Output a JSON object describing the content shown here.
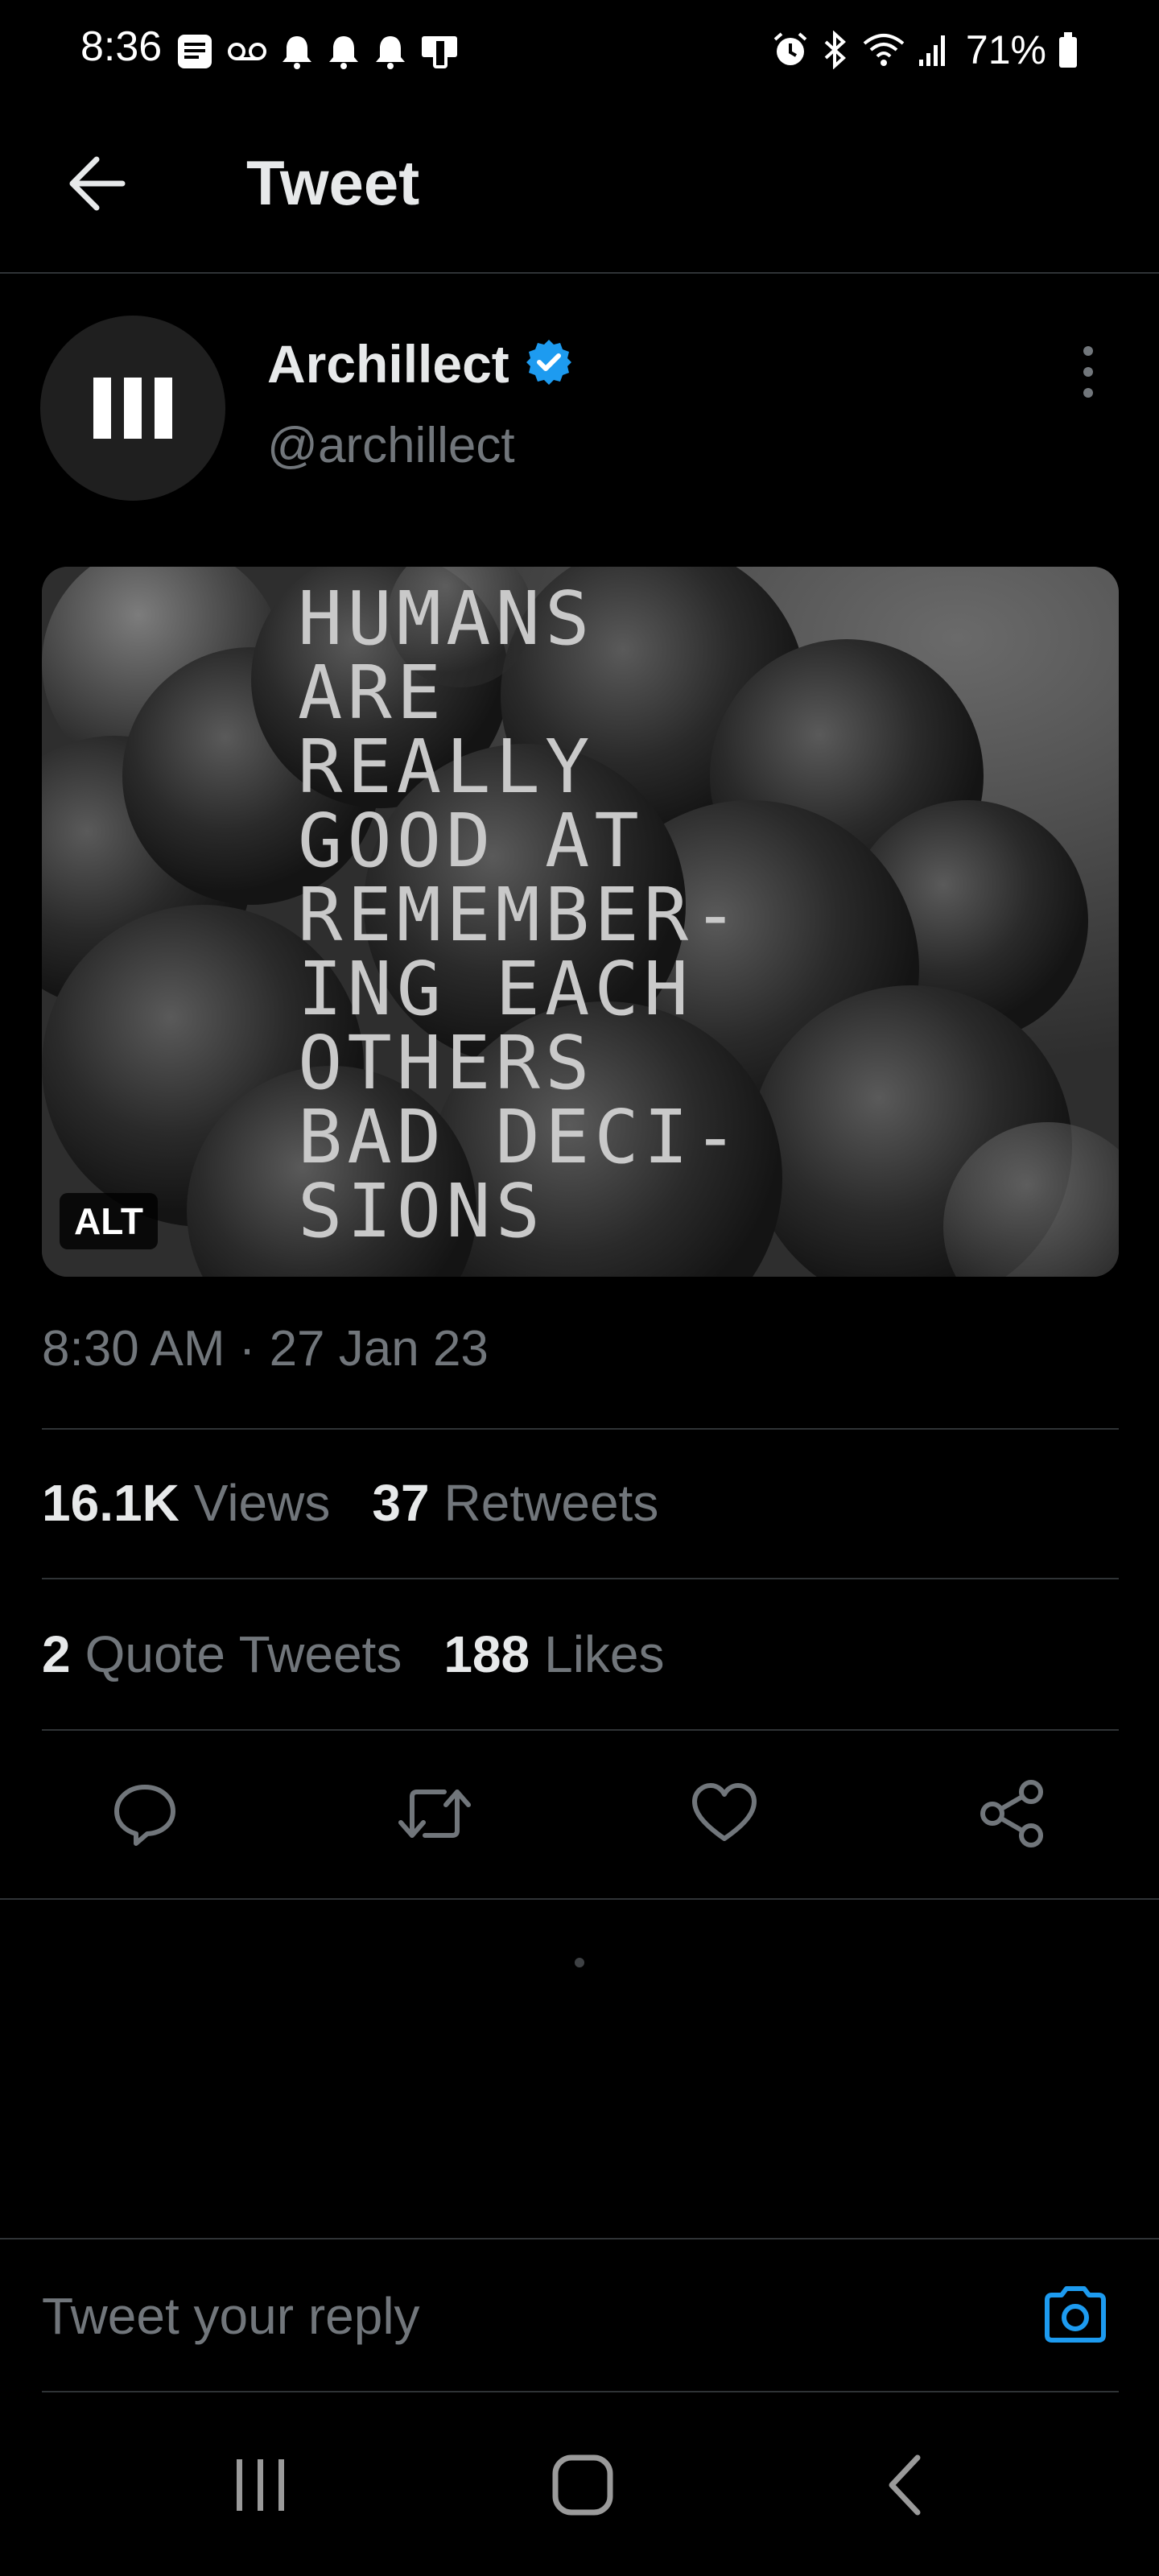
{
  "status_bar": {
    "time": "8:36",
    "battery": "71%",
    "left_icons": [
      "message-icon",
      "voicemail-icon",
      "bell-icon",
      "bell-icon",
      "bell-icon",
      "device-icon"
    ],
    "right_icons": [
      "alarm-icon",
      "bluetooth-icon",
      "wifi-icon",
      "signal-icon",
      "battery-icon"
    ]
  },
  "header": {
    "back_icon": "arrow-left-icon",
    "title": "Tweet"
  },
  "tweet": {
    "author": {
      "name": "Archillect",
      "handle": "@archillect",
      "verified": true,
      "verified_color": "#1d9bf0"
    },
    "media": {
      "alt_badge": "ALT",
      "text_lines": [
        "HUMANS",
        "ARE",
        "REALLY",
        "GOOD AT",
        "REMEMBER-",
        "ING EACH",
        "OTHERS",
        "BAD DECI-",
        "SIONS"
      ]
    },
    "timestamp": "8:30 AM · 27 Jan 23",
    "stats": {
      "views_count": "16.1K",
      "views_label": "Views",
      "retweets_count": "37",
      "retweets_label": "Retweets",
      "quotes_count": "2",
      "quotes_label": "Quote Tweets",
      "likes_count": "188",
      "likes_label": "Likes"
    },
    "actions": [
      "reply-icon",
      "retweet-icon",
      "like-icon",
      "share-icon"
    ]
  },
  "reply": {
    "placeholder": "Tweet your reply",
    "camera_color": "#1d9bf0"
  },
  "nav": [
    "recents-icon",
    "home-icon",
    "back-icon"
  ]
}
